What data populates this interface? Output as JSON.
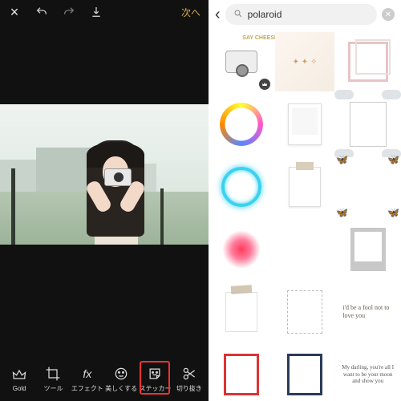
{
  "editor": {
    "next": "次へ",
    "tools": {
      "gold": "Gold",
      "tool": "ツール",
      "effect": "エフェクト",
      "beautify": "美しくする",
      "sticker": "ステッカー",
      "cutout": "切り抜き"
    }
  },
  "search": {
    "query": "polaroid"
  },
  "stickers": {
    "camera_text": "SAY\nCHEESE",
    "text1": "i'd be a fool\nnot to love you",
    "text2": "My darling,\nyou're all I want\nto be your moon\nand show you"
  }
}
